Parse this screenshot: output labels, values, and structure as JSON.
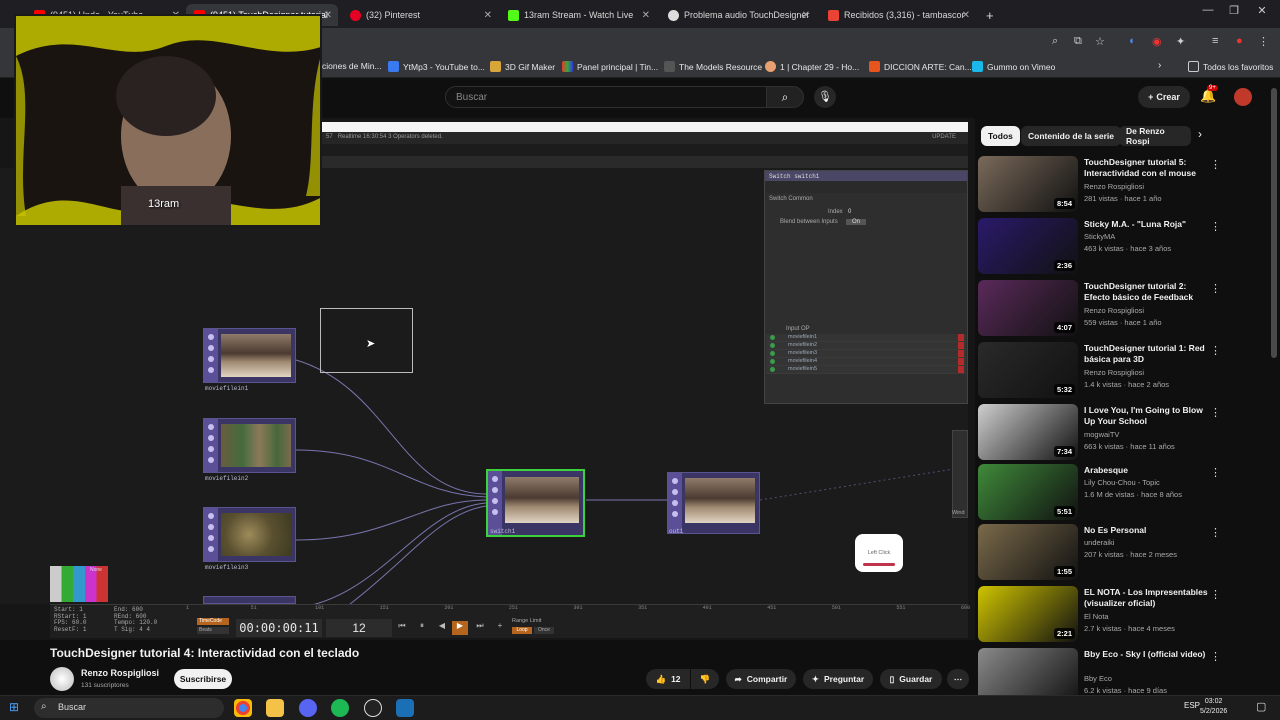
{
  "browser": {
    "tabs": [
      {
        "label": "(9451) Undo - YouTube",
        "active": false
      },
      {
        "label": "(9451) TouchDesigner tutorial",
        "active": true
      },
      {
        "label": "(32) Pinterest",
        "active": false
      },
      {
        "label": "13ram Stream - Watch Live",
        "active": false
      },
      {
        "label": "Problema audio TouchDesigner",
        "active": false
      },
      {
        "label": "Recibidos (3,316) - tambascor",
        "active": false
      }
    ],
    "new_tab": "+",
    "bookmarks": [
      "ciones de Min...",
      "YtMp3 - YouTube to...",
      "3D Gif Maker",
      "Panel principal | Tin...",
      "The Models Resource",
      "1 | Chapter 29 - Ho...",
      "DICCION ARTE: Can...",
      "Gummo on Vimeo"
    ],
    "all_favorites": "Todos los favoritos"
  },
  "youtube": {
    "search_placeholder": "Buscar",
    "create_label": "Crear",
    "notif_count": "9+",
    "video_title": "TouchDesigner tutorial 4: Interactividad con el teclado",
    "channel": "Renzo Rospigliosi",
    "subscribers": "131 suscriptores",
    "subscribe": "Suscribirse",
    "likes": "12",
    "share": "Compartir",
    "ask": "Preguntar",
    "save": "Guardar",
    "chips": [
      "Todos",
      "Contenido de la serie",
      "De Renzo Rospi"
    ],
    "recommendations": [
      {
        "title": "TouchDesigner tutorial 5: Interactividad con el mouse",
        "channel": "Renzo Rospigliosi",
        "meta": "281 vistas · hace 1 año",
        "duration": "8:54",
        "thumb": "#7a6a5a"
      },
      {
        "title": "Sticky M.A. - \"Luna Roja\"",
        "channel": "StickyMA",
        "meta": "463 k vistas · hace 3 años",
        "duration": "2:36",
        "thumb": "#2a1a6a"
      },
      {
        "title": "TouchDesigner tutorial 2: Efecto básico de Feedback",
        "channel": "Renzo Rospigliosi",
        "meta": "559 vistas · hace 1 año",
        "duration": "4:07",
        "thumb": "#5a2a5a"
      },
      {
        "title": "TouchDesigner tutorial 1: Red básica para 3D",
        "channel": "Renzo Rospigliosi",
        "meta": "1.4 k vistas · hace 2 años",
        "duration": "5:32",
        "thumb": "#2a2a2a"
      },
      {
        "title": "I Love You, I'm Going to Blow Up Your School",
        "channel": "mogwaiTV",
        "meta": "663 k vistas · hace 11 años",
        "duration": "7:34",
        "thumb": "#cfcfcf"
      },
      {
        "title": "Arabesque",
        "channel": "Lily Chou-Chou - Topic",
        "meta": "1.6 M de vistas · hace 8 años",
        "duration": "5:51",
        "thumb": "#3f8a3a"
      },
      {
        "title": "No Es Personal",
        "channel": "underaiki",
        "meta": "207 k vistas · hace 2 meses",
        "duration": "1:55",
        "thumb": "#7a6a4a"
      },
      {
        "title": "EL NOTA - Los Impresentables (visualizer oficial)",
        "channel": "El Nota",
        "meta": "2.7 k vistas · hace 4 meses",
        "duration": "2:21",
        "thumb": "#cfc400"
      },
      {
        "title": "Bby Eco - Sky I (official video)",
        "channel": "Bby Eco",
        "meta": "6.2 k vistas · hace 9 días",
        "duration": "",
        "thumb": "#8a8a8a"
      }
    ]
  },
  "touchdesigner": {
    "status_text": "Realtime   16:30:54 3 Operators deleted.",
    "status_num": "57",
    "update_label": "UPDATE",
    "switch_header": "Switch   switch1",
    "param_tabs": "Switch   Common",
    "index_label": "Index",
    "index_value": "0",
    "blend_label": "Blend between Inputs",
    "blend_value": "On",
    "input_op_label": "Input OP",
    "inputs": [
      "moviefilein1",
      "moviefilein2",
      "moviefilein3",
      "moviefilein4",
      "moviefilein5"
    ],
    "operators": [
      {
        "name": "moviefilein1"
      },
      {
        "name": "moviefilein2"
      },
      {
        "name": "moviefilein3"
      },
      {
        "name": "switch1"
      },
      {
        "name": "out1"
      }
    ],
    "none_label": "None",
    "side_label": "Wind",
    "left_click_label": "Left Click",
    "timeline": {
      "timecode": "00:00:00:11",
      "frame": "12",
      "start_label": "Start:",
      "start": "1",
      "end_label": "End:",
      "end": "600",
      "rstart_label": "RStart:",
      "rstart": "1",
      "rend_label": "REnd:",
      "rend": "600",
      "fps_label": "FPS:",
      "fps": "60.0",
      "tempo_label": "Tempo:",
      "tempo": "120.0",
      "resetf_label": "ResetF:",
      "resetf": "1",
      "tsig_label": "T Sig:",
      "tsig": "4   4",
      "timecode_label": "TimeCode",
      "beats_label": "Beats",
      "range_limit": "Range Limit",
      "loop": "Loop",
      "once": "Once",
      "ticks": [
        "1",
        "51",
        "101",
        "151",
        "201",
        "251",
        "301",
        "351",
        "401",
        "451",
        "501",
        "551",
        "600"
      ]
    }
  },
  "webcam": {
    "caption": "13ram"
  },
  "taskbar": {
    "search": "Buscar",
    "lang": "ESP",
    "time": "03:02",
    "date": "5/2/2026"
  }
}
